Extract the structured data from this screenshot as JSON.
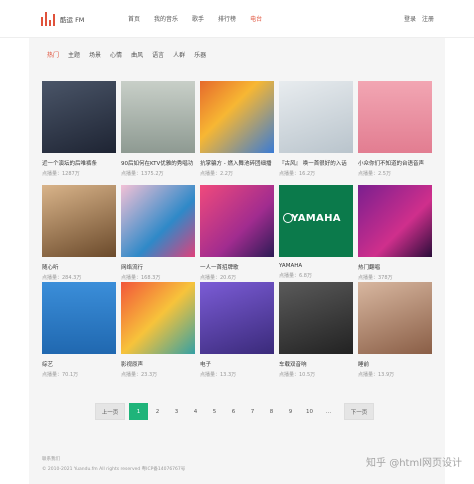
{
  "header": {
    "logo_text": "酷运 FM",
    "nav": [
      "首页",
      "我的音乐",
      "歌手",
      "排行榜",
      "电台"
    ],
    "active_nav": 4,
    "login": "登录",
    "register": "注册"
  },
  "categories": {
    "items": [
      "热门",
      "主题",
      "场景",
      "心情",
      "曲风",
      "语言",
      "人群",
      "乐器"
    ],
    "active": 0
  },
  "stations": [
    {
      "title": "近一个演坛的后唯裤条",
      "plays": "点播量：1287万"
    },
    {
      "title": "90后如何在KTV优雅的秀唱功",
      "plays": "点播量：1375.2万"
    },
    {
      "title": "抗掌骗方 - 燃入舞池碎团细播",
      "plays": "点播量：2.2万"
    },
    {
      "title": "『古风』 唤一首很好的入话",
      "plays": "点播量：16.2万"
    },
    {
      "title": "小众你们不知道的台语音声",
      "plays": "点播量：2.5万"
    },
    {
      "title": "随心听",
      "plays": "点播量：284.3万"
    },
    {
      "title": "网络流行",
      "plays": "点播量：168.3万"
    },
    {
      "title": "一人一首招牌歌",
      "plays": "点播量：20.6万"
    },
    {
      "title": "YAMAHA",
      "plays": "点播量：6.8万"
    },
    {
      "title": "热门翻唱",
      "plays": "点播量：378万"
    },
    {
      "title": "综艺",
      "plays": "点播量：70.1万"
    },
    {
      "title": "影视原声",
      "plays": "点播量：23.3万"
    },
    {
      "title": "电子",
      "plays": "点播量：13.3万"
    },
    {
      "title": "车载双音响",
      "plays": "点播量：10.5万"
    },
    {
      "title": "睡前",
      "plays": "点播量：13.9万"
    }
  ],
  "yamaha_logo_text": "YAMAHA",
  "pagination": {
    "prev": "上一页",
    "next": "下一页",
    "pages": [
      "1",
      "2",
      "3",
      "4",
      "5",
      "6",
      "7",
      "8",
      "9",
      "10",
      "..."
    ],
    "active": 0
  },
  "footer": {
    "line1": "联系我们",
    "line2": "© 2010-2021 Yuandu.fm All rights reserved 粤ICP备14076767号"
  },
  "watermark": "知乎 @html网页设计",
  "colors": {
    "accent": "#e0523b",
    "page_active": "#1fb47a"
  }
}
